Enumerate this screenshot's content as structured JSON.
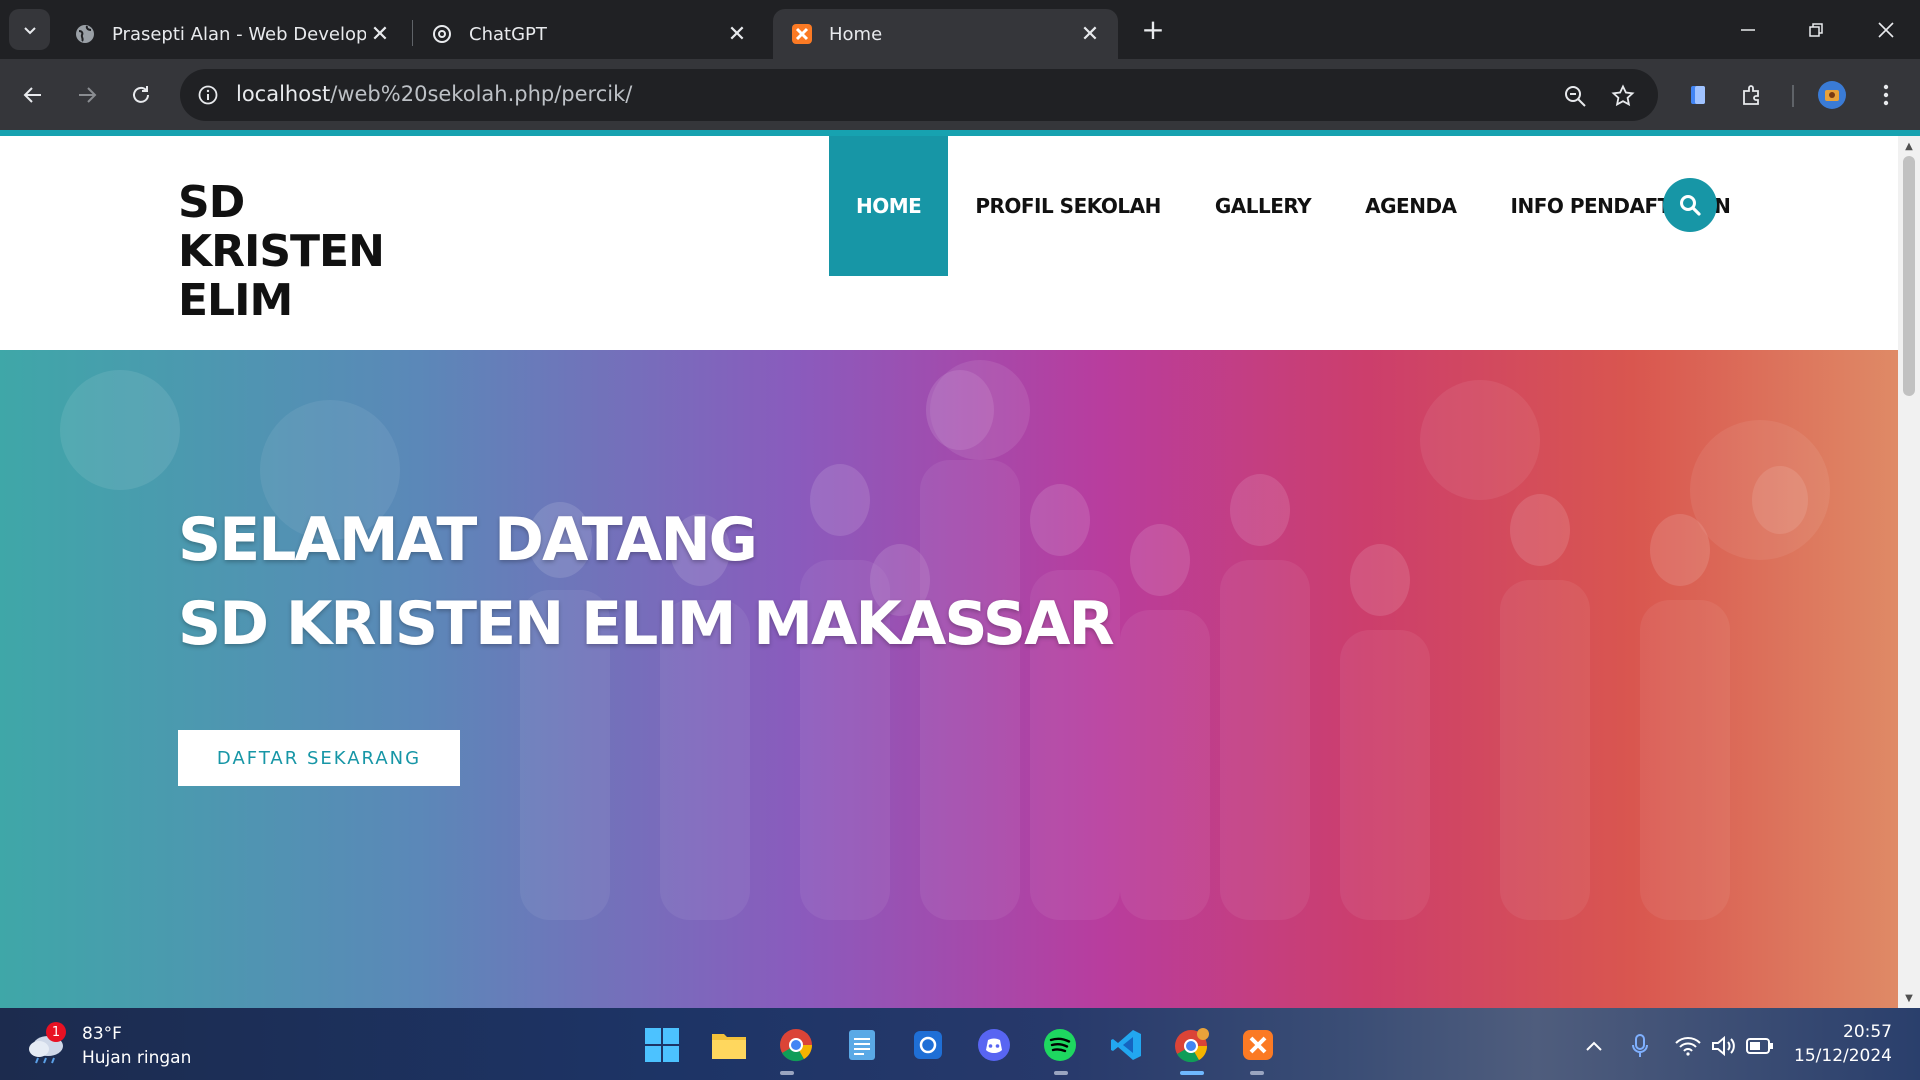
{
  "browser": {
    "tabs": [
      {
        "title": "Prasepti Alan - Web Developer",
        "icon": "globe-icon",
        "active": false
      },
      {
        "title": "ChatGPT",
        "icon": "chatgpt-icon",
        "active": false
      },
      {
        "title": "Home",
        "icon": "xampp-icon",
        "active": true
      }
    ],
    "url": {
      "host": "localhost",
      "path": "/web%20sekolah.php/percik/"
    },
    "accent_color": "#17a2b0"
  },
  "site": {
    "logo_lines": [
      "SD",
      "KRISTEN",
      "ELIM"
    ],
    "nav": [
      {
        "label": "HOME",
        "active": true
      },
      {
        "label": "PROFIL SEKOLAH",
        "active": false
      },
      {
        "label": "GALLERY",
        "active": false
      },
      {
        "label": "AGENDA",
        "active": false
      },
      {
        "label": "INFO PENDAFTARAN",
        "active": false
      }
    ],
    "brand_color": "#1796a6",
    "hero": {
      "title_lines": [
        "SELAMAT DATANG",
        "SD KRISTEN ELIM MAKASSAR"
      ],
      "cta_label": "DAFTAR SEKARANG"
    }
  },
  "taskbar": {
    "weather": {
      "temp": "83°F",
      "desc": "Hujan ringan",
      "badge": "1"
    },
    "apps": [
      "windows-start-icon",
      "file-explorer-icon",
      "chrome-icon",
      "notepad-icon",
      "snipping-tool-icon",
      "discord-icon",
      "spotify-icon",
      "vscode-icon",
      "chrome-profile-icon",
      "xampp-icon"
    ],
    "clock": {
      "time": "20:57",
      "date": "15/12/2024"
    }
  }
}
